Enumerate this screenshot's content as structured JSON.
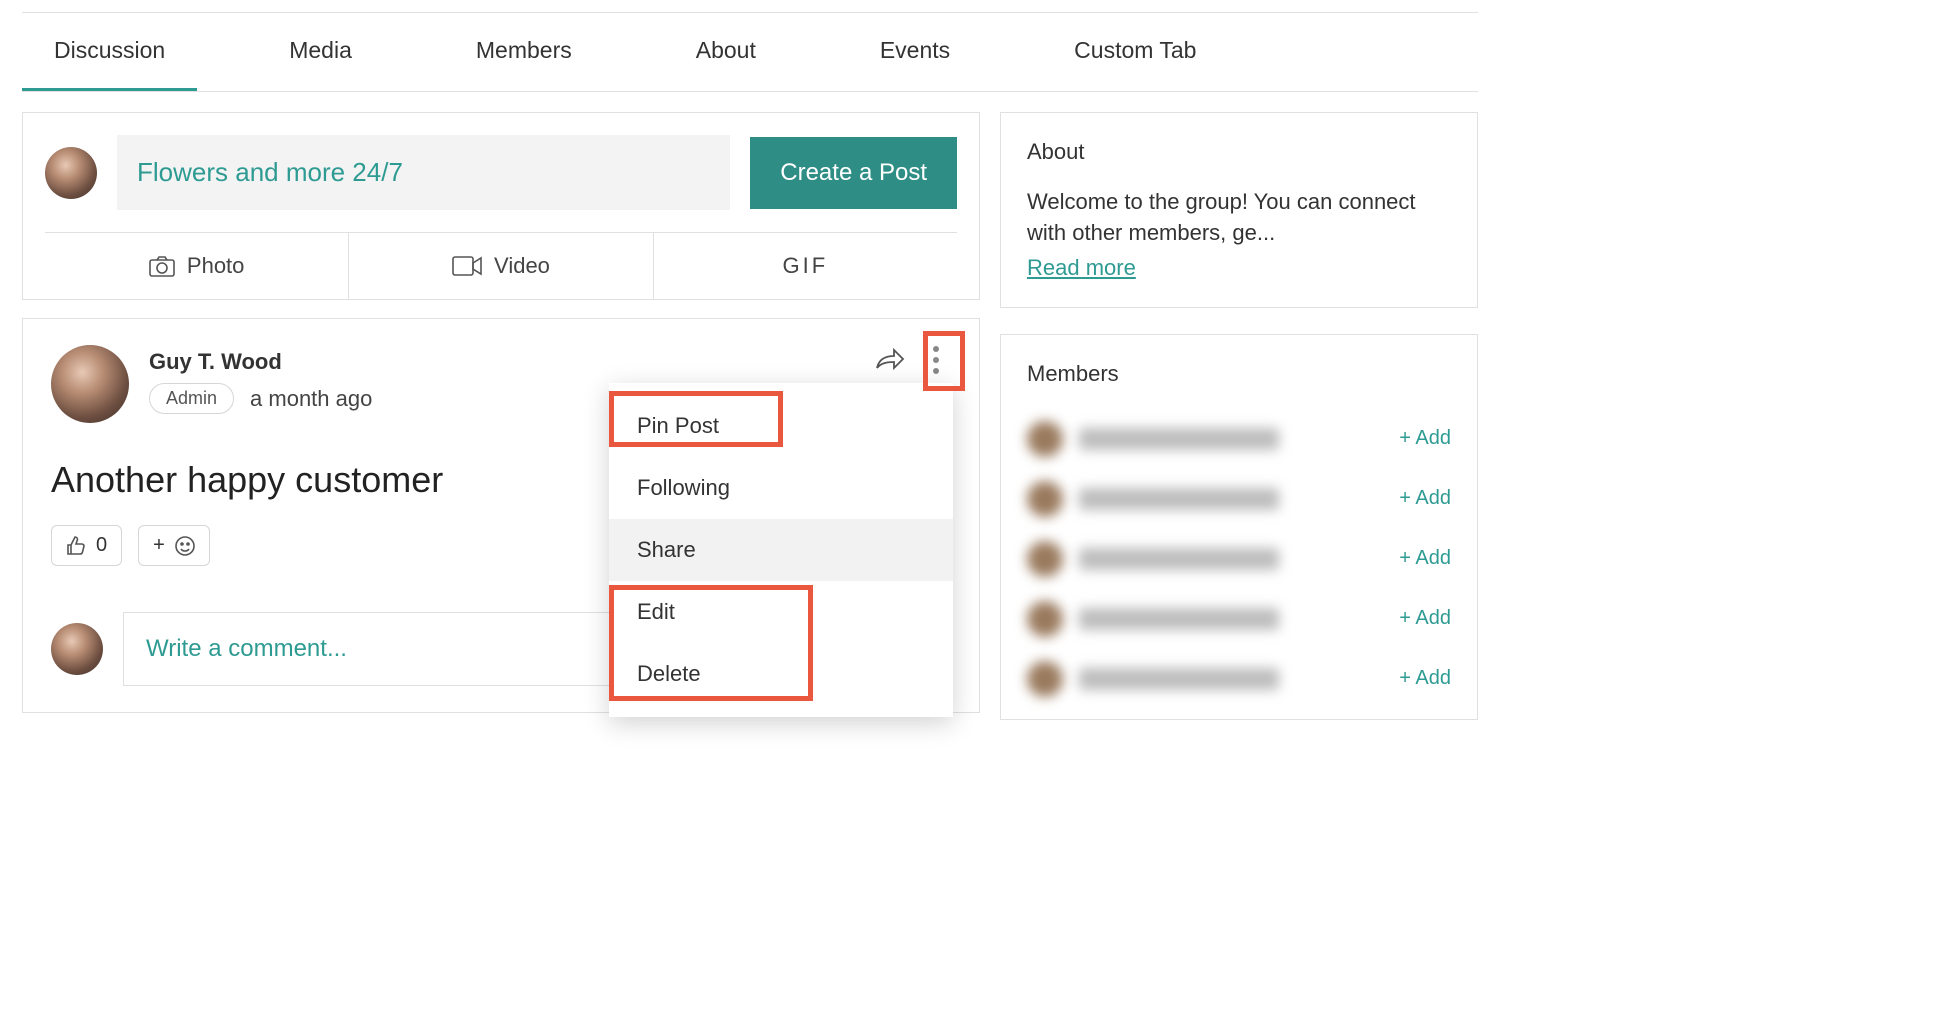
{
  "tabs": [
    "Discussion",
    "Media",
    "Members",
    "About",
    "Events",
    "Custom Tab"
  ],
  "activeTab": 0,
  "composer": {
    "placeholderValue": "Flowers and more 24/7",
    "createButton": "Create a Post",
    "options": {
      "photo": "Photo",
      "video": "Video",
      "gif": "GIF"
    }
  },
  "post": {
    "author": "Guy T. Wood",
    "badge": "Admin",
    "timestamp": "a month ago",
    "body": "Another happy customer",
    "likeCount": "0",
    "addReaction": "+"
  },
  "dropdown": {
    "pin": "Pin Post",
    "following": "Following",
    "share": "Share",
    "edit": "Edit",
    "delete": "Delete"
  },
  "comment": {
    "placeholder": "Write a comment..."
  },
  "about": {
    "title": "About",
    "text": "Welcome to the group! You can connect with other members, ge...",
    "readMore": "Read more"
  },
  "members": {
    "title": "Members",
    "addLabel": "+ Add",
    "count": 5
  }
}
